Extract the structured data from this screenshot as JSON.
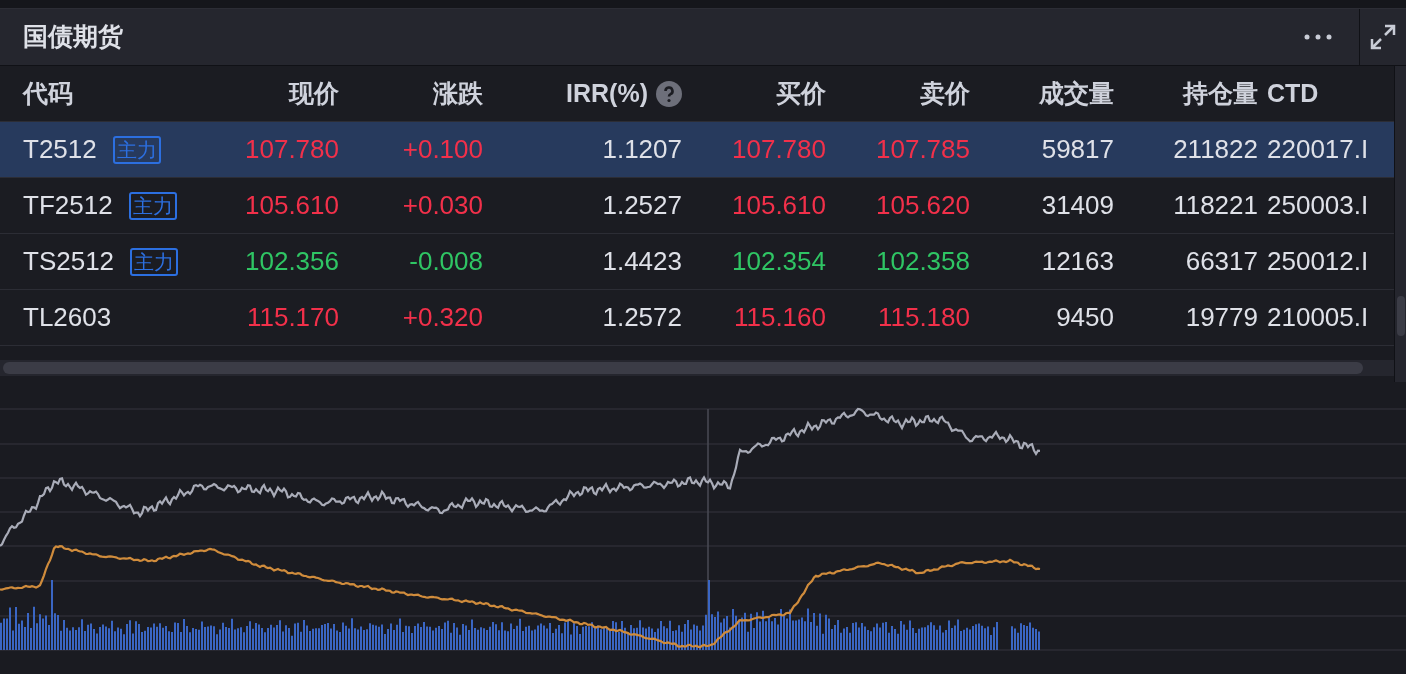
{
  "panel": {
    "title": "国债期货"
  },
  "table": {
    "columns": [
      "代码",
      "现价",
      "涨跌",
      "IRR(%)",
      "买价",
      "卖价",
      "成交量",
      "持仓量",
      "CTD"
    ],
    "rows": [
      {
        "code": "T2512",
        "badge": "主力",
        "up": true,
        "selected": true,
        "price": "107.780",
        "change": "+0.100",
        "irr": "1.1207",
        "bid": "107.780",
        "ask": "107.785",
        "volume": "59817",
        "open_interest": "211822",
        "ctd": "220017.I"
      },
      {
        "code": "TF2512",
        "badge": "主力",
        "up": true,
        "selected": false,
        "price": "105.610",
        "change": "+0.030",
        "irr": "1.2527",
        "bid": "105.610",
        "ask": "105.620",
        "volume": "31409",
        "open_interest": "118221",
        "ctd": "250003.I"
      },
      {
        "code": "TS2512",
        "badge": "主力",
        "up": false,
        "selected": false,
        "price": "102.356",
        "change": "-0.008",
        "irr": "1.4423",
        "bid": "102.354",
        "ask": "102.358",
        "volume": "12163",
        "open_interest": "66317",
        "ctd": "250012.I"
      },
      {
        "code": "TL2603",
        "up": true,
        "selected": false,
        "price": "115.170",
        "change": "+0.320",
        "irr": "1.2572",
        "bid": "115.160",
        "ask": "115.180",
        "volume": "9450",
        "open_interest": "19779",
        "ctd": "210005.I"
      }
    ]
  }
}
